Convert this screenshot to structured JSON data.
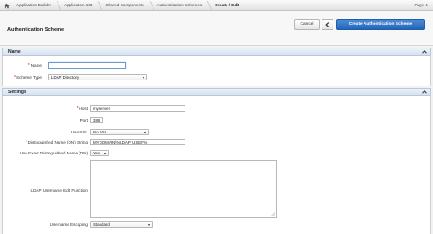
{
  "breadcrumb": {
    "home_icon": "home-icon",
    "items": [
      "Application Builder",
      "Application 103",
      "Shared Components",
      "Authentication Schemes",
      "Create / Edit"
    ],
    "page_indicator": "Page 1"
  },
  "header": {
    "title": "Authentication Scheme",
    "cancel_label": "Cancel",
    "prev_icon": "chevron-left-icon",
    "create_label": "Create Authentication Scheme"
  },
  "name_region": {
    "title": "Name",
    "name_label": "Name",
    "name_value": "",
    "scheme_type_label": "Scheme Type",
    "scheme_type_value": "LDAP Directory"
  },
  "settings_region": {
    "title": "Settings",
    "host_label": "Host",
    "host_value": "myserver",
    "port_label": "Port",
    "port_value": "389",
    "use_ssl_label": "Use SSL",
    "use_ssl_value": "No SSL",
    "dn_string_label": "Distinguished Name (DN) String",
    "dn_string_value": "MYDOMAIN\\%LDAP_USER%",
    "exact_dn_label": "Use Exact Distinguished Name (DN)",
    "exact_dn_value": "Yes",
    "edit_function_label": "LDAP Username Edit Function",
    "edit_function_value": "",
    "escaping_label": "Username Escaping",
    "escaping_value": "Standard"
  },
  "colors": {
    "primary_button": "#2464b7",
    "required_marker": "#d11111",
    "region_header": "#d6e2ef"
  }
}
